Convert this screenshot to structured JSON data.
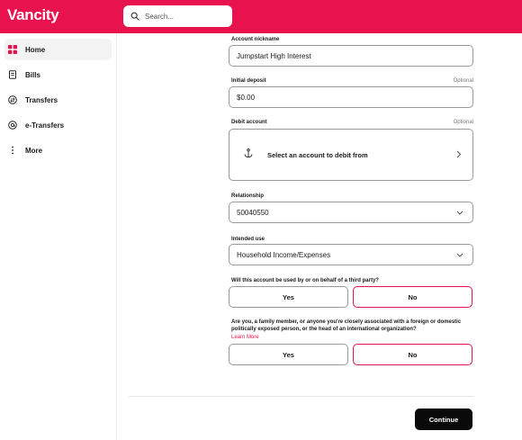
{
  "brand": {
    "name": "Vancity"
  },
  "search": {
    "placeholder": "Search..."
  },
  "sidebar": {
    "items": [
      {
        "label": "Home",
        "icon": "home-grid-icon",
        "active": true
      },
      {
        "label": "Bills",
        "icon": "bill-icon"
      },
      {
        "label": "Transfers",
        "icon": "transfer-icon"
      },
      {
        "label": "e-Transfers",
        "icon": "e-transfer-icon"
      },
      {
        "label": "More",
        "icon": "more-icon"
      }
    ]
  },
  "form": {
    "nickname": {
      "label": "Account nickname",
      "value": "Jumpstart High Interest"
    },
    "deposit": {
      "label": "Initial deposit",
      "optional": "Optional",
      "value": "$0.00"
    },
    "debit": {
      "label": "Debit account",
      "optional": "Optional",
      "cta": "Select an account to debit from"
    },
    "relationship": {
      "label": "Relationship",
      "value": "50040550"
    },
    "intended_use": {
      "label": "Intended use",
      "value": "Household Income/Expenses"
    },
    "third_party": {
      "question": "Will this account be used by or on behalf of a third party?",
      "yes": "Yes",
      "no": "No",
      "selected": "No"
    },
    "pep": {
      "question": "Are you, a family member, or anyone you're closely associated with a foreign or domestic politically exposed person, or the head of an international organization?",
      "learn_more": "Learn More",
      "yes": "Yes",
      "no": "No",
      "selected": "No"
    },
    "continue": "Continue"
  },
  "colors": {
    "accent": "#e8124f",
    "primary_button": "#0a0a0a"
  }
}
